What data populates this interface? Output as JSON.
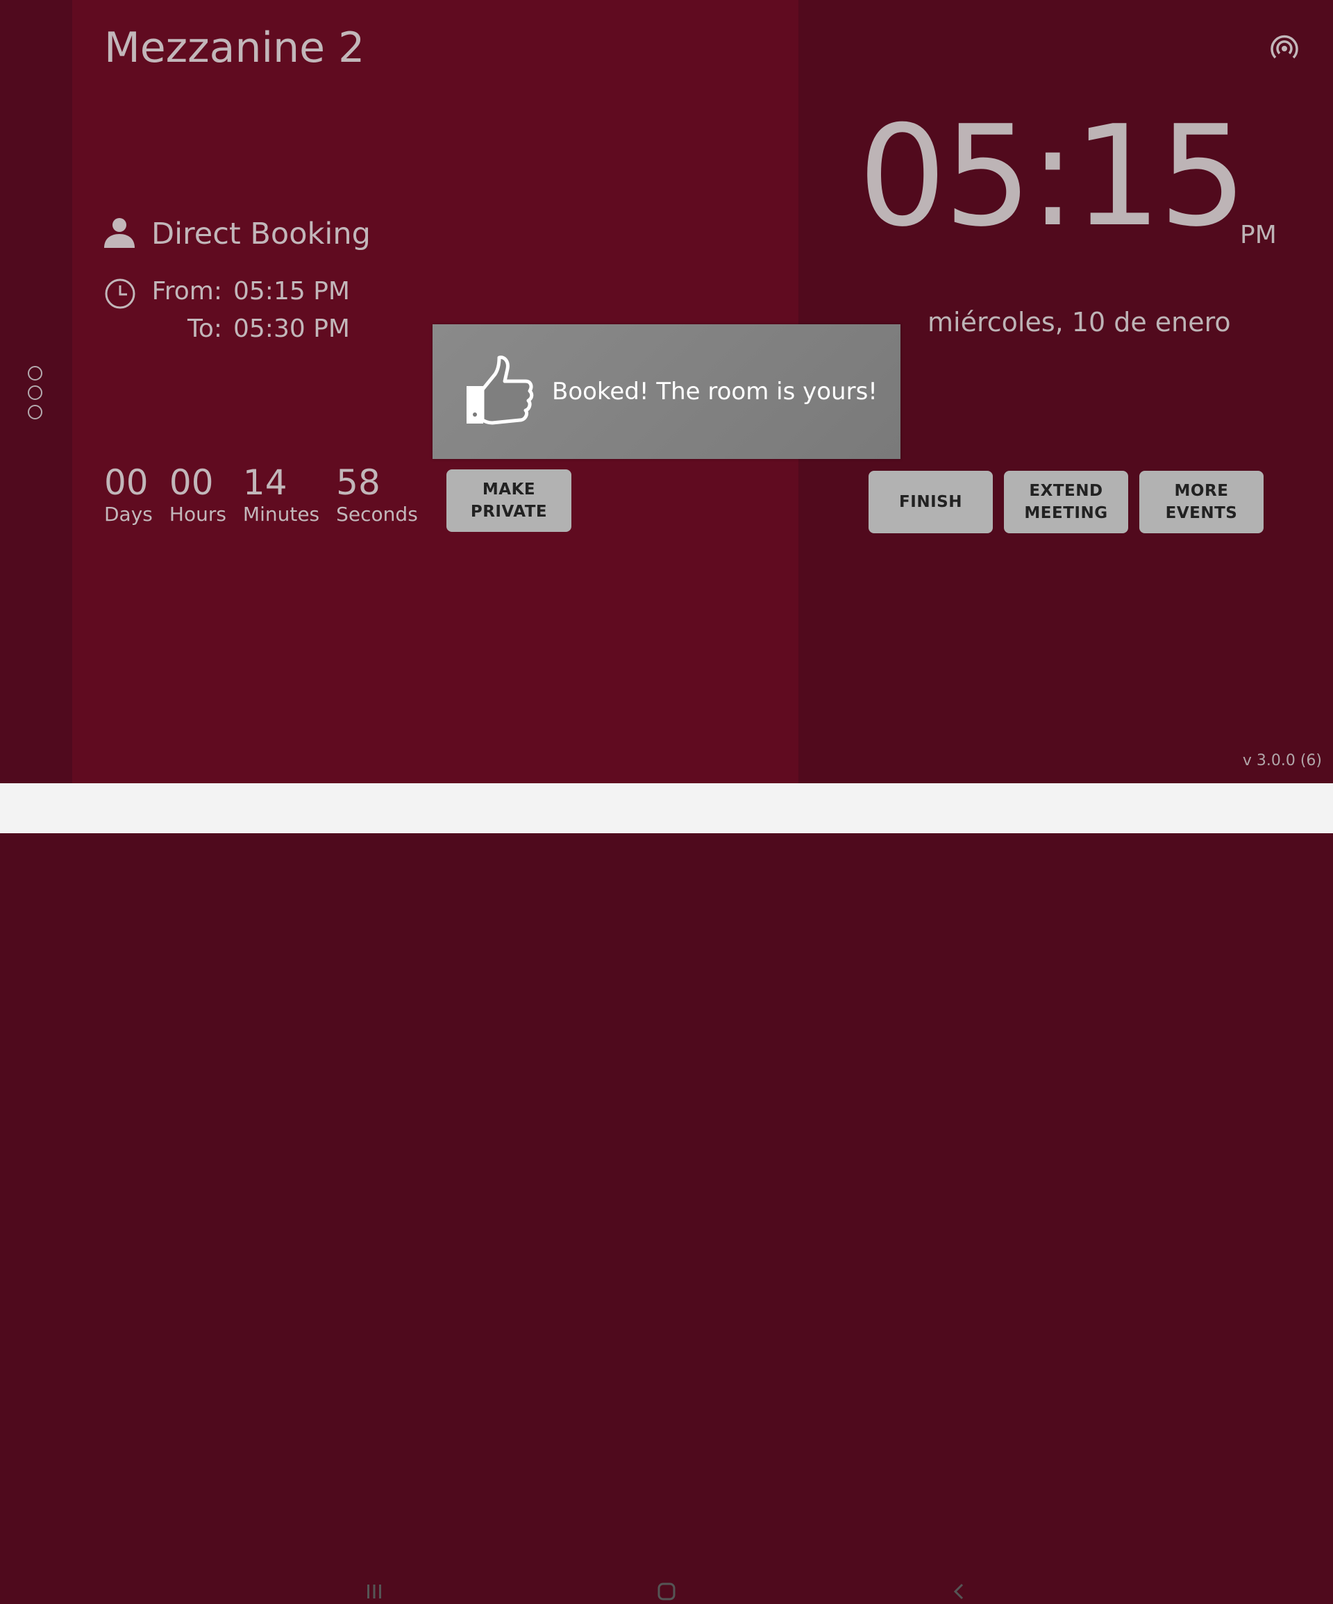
{
  "room": {
    "title": "Mezzanine 2"
  },
  "booking": {
    "organizer": "Direct Booking",
    "from_label": "From:",
    "from_time": "05:15 PM",
    "to_label": "To:",
    "to_time": "05:30 PM"
  },
  "countdown": {
    "days": "00",
    "days_label": "Days",
    "hours": "00",
    "hours_label": "Hours",
    "minutes": "14",
    "minutes_label": "Minutes",
    "seconds": "58",
    "seconds_label": "Seconds"
  },
  "buttons": {
    "make_private_1": "MAKE",
    "make_private_2": "PRIVATE",
    "finish": "FINISH",
    "extend_1": "EXTEND",
    "extend_2": "MEETING",
    "more_1": "MORE",
    "more_2": "EVENTS"
  },
  "clock": {
    "time": "05:15",
    "ampm": "PM",
    "date": "miércoles, 10 de enero"
  },
  "toast": {
    "message": "Booked! The room is yours!"
  },
  "footer": {
    "version": "v 3.0.0 (6)"
  },
  "icons": {
    "menu": "more-vertical-icon",
    "organizer": "person-icon",
    "time": "clock-icon",
    "status": "broadcast-icon",
    "toast": "thumbs-up-icon",
    "nav": [
      "recent-apps-icon",
      "home-icon",
      "back-icon"
    ]
  },
  "colors": {
    "main_bg": "#600b20",
    "side_bg": "#510a1d",
    "button_bg": "#b2b2b2",
    "toast_bg": "#828282",
    "nav_bg": "#f3f3f3"
  }
}
